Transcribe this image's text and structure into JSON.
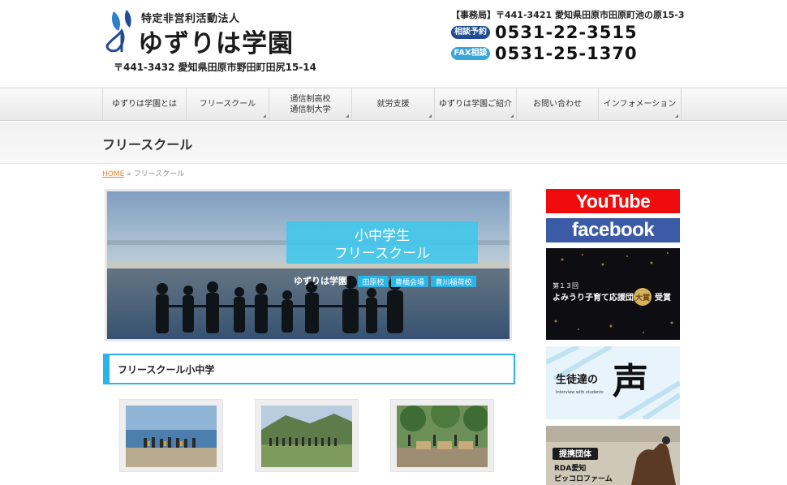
{
  "header": {
    "logo_sub": "特定非営利活動法人",
    "logo_main": "ゆずりは学園",
    "address": "〒441-3432 愛知県田原市野田町田尻15-14"
  },
  "contact": {
    "office": "【事務局】〒441-3421 愛知県田原市田原町池の原15-3",
    "phones": [
      {
        "badge": "相談予約",
        "number": "0531-22-3515",
        "color": "#1f4c93"
      },
      {
        "badge": "FAX相談",
        "number": "0531-25-1370",
        "color": "#3aa6d8"
      }
    ]
  },
  "nav": {
    "items": [
      {
        "label": "ゆずりは学園とは",
        "line2": ""
      },
      {
        "label": "フリースクール",
        "line2": ""
      },
      {
        "label": "通信制高校",
        "line2": "通信制大学"
      },
      {
        "label": "就労支援",
        "line2": ""
      },
      {
        "label": "ゆずりは学園ご紹介",
        "line2": ""
      },
      {
        "label": "お問い合わせ",
        "line2": ""
      },
      {
        "label": "インフォメーション",
        "line2": ""
      }
    ]
  },
  "page": {
    "title": "フリースクール",
    "breadcrumb_home": "HOME",
    "breadcrumb_sep": "»",
    "breadcrumb_current": "フリースクール"
  },
  "hero": {
    "line1": "小中学生",
    "line2": "フリースクール",
    "brand": "ゆずりは学園",
    "schools": [
      "田原校",
      "豊橋会場",
      "豊川稲荷校"
    ]
  },
  "section": {
    "heading": "フリースクール小中学"
  },
  "sidebar": {
    "youtube": "YouTube",
    "facebook": "facebook",
    "award_line1": "第１３回",
    "award_line2": "よみうり子育て応援団",
    "award_badge": "大賞",
    "award_suffix": "受賞",
    "voice_prefix": "生徒達の",
    "voice_kanji": "声",
    "voice_sub": "Interview with students",
    "rda_badge": "提携団体",
    "rda_line1": "RDA愛知",
    "rda_line2": "ピッコロファーム"
  },
  "colors": {
    "accent": "#2bb5e5",
    "link": "#e8842c",
    "youtube": "#f00c0c",
    "facebook": "#3b5ba6"
  }
}
